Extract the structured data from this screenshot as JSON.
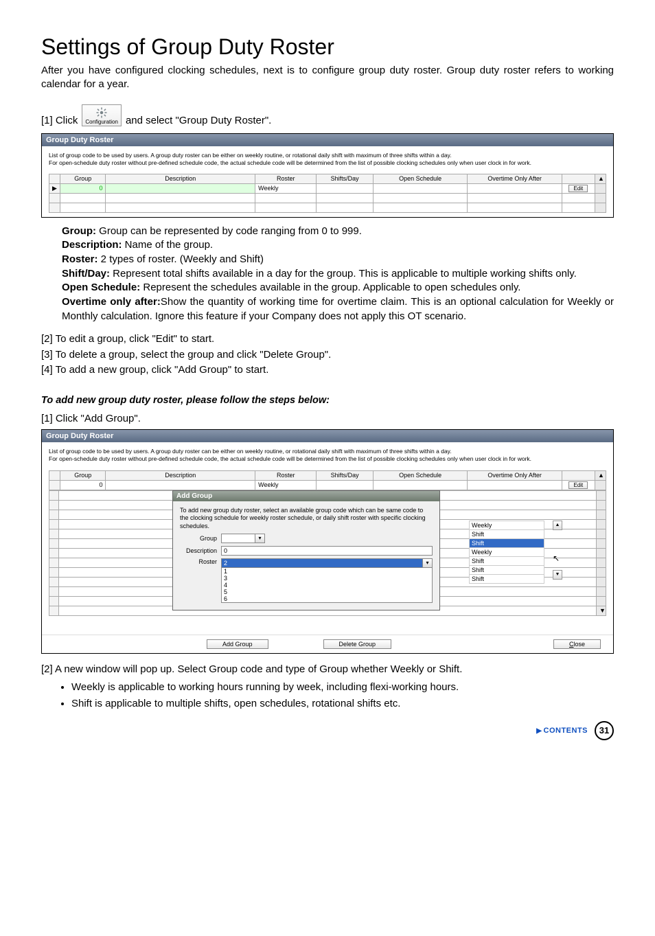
{
  "title": "Settings of Group Duty Roster",
  "intro": "After you have configured clocking schedules, next is to configure group duty roster. Group duty roster refers to working calendar for a year.",
  "step1_prefix": "[1]  Click",
  "config_label": "Configuration",
  "step1_suffix": "and select \"Group Duty Roster\".",
  "shot_title": "Group Duty Roster",
  "shot_note1": "List of group code to be used by users. A group duty roster can be either on weekly routine, or rotational daily shift with maximum of three shifts within a day.",
  "shot_note2": "For open-schedule duty roster without pre-defined schedule code, the actual schedule code will be determined from the list of possible clocking schedules only when user clock in for work.",
  "cols": {
    "group": "Group",
    "desc": "Description",
    "roster": "Roster",
    "shifts": "Shifts/Day",
    "open": "Open Schedule",
    "ot": "Overtime Only After"
  },
  "row": {
    "group": "0",
    "desc": "",
    "roster": "Weekly",
    "shifts": "",
    "open": "",
    "ot": ""
  },
  "edit_btn": "Edit",
  "defs": {
    "group_l": "Group:",
    "group_t": " Group can be represented by code ranging from 0 to 999.",
    "desc_l": "Description:",
    "desc_t": " Name of the group.",
    "roster_l": "Roster:",
    "roster_t": " 2 types of roster. (Weekly and Shift)",
    "shift_l": "Shift/Day:",
    "shift_t": " Represent total shifts available in a day for the group. This is applicable to multiple working shifts only.",
    "open_l": "Open Schedule:",
    "open_t": " Represent the schedules available in the group. Applicable to open schedules only.",
    "ot_l": "Overtime only after:",
    "ot_t": "Show the quantity of working time for overtime claim. This is an optional calculation for Weekly or Monthly calculation. Ignore this feature if your Company does not apply this OT scenario."
  },
  "steps": {
    "s2": "[2]  To edit a group, click \"Edit\" to start.",
    "s3": "[3]  To delete a group, select the group and click \"Delete Group\".",
    "s4": "[4]  To add a new group, click \"Add Group\" to start."
  },
  "subhead": "To add new group duty roster, please follow the steps below:",
  "sub1": "[1]  Click \"Add Group\".",
  "add_dialog": {
    "title": "Add Group",
    "note": "To add new group duty roster, select an available group code which can be same code to the clocking schedule for weekly roster schedule, or daily shift roster with specific clocking schedules.",
    "group_l": "Group",
    "desc_l": "Description",
    "roster_l": "Roster",
    "group_val": "",
    "desc_val": "0",
    "roster_val": "2",
    "numbers": [
      "1",
      "3",
      "4",
      "5",
      "6"
    ]
  },
  "right_options": [
    "Weekly",
    "Shift",
    "Shift",
    "Weekly",
    "Shift",
    "Shift",
    "Shift"
  ],
  "right_selected_index": 2,
  "buttons": {
    "add": "Add Group",
    "del": "Delete Group",
    "close": "Close"
  },
  "post2": "[2]  A new window will pop up. Select Group code and type of Group whether Weekly or Shift.",
  "bullets": [
    "Weekly is applicable to working hours running by week, including flexi-working hours.",
    "Shift is applicable to multiple shifts, open schedules, rotational shifts etc."
  ],
  "footer": {
    "contents": "CONTENTS",
    "page": "31"
  }
}
